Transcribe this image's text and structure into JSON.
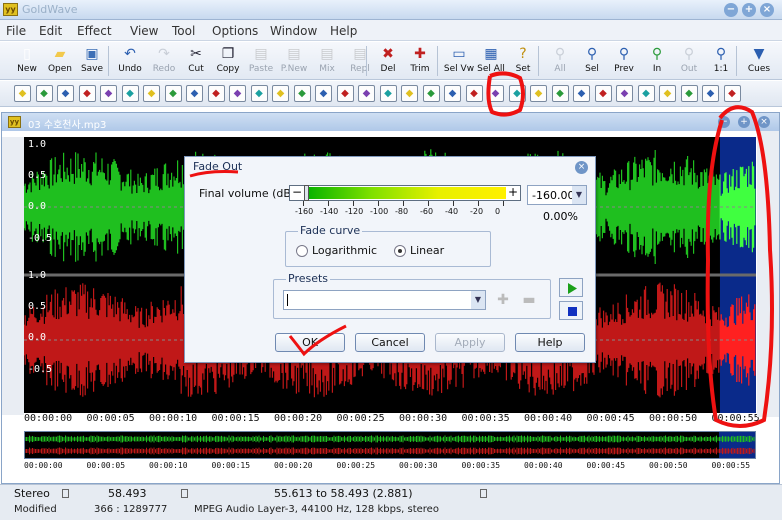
{
  "app": {
    "title": "GoldWave",
    "logo": "yy",
    "window_buttons": [
      "−",
      "+",
      "×"
    ]
  },
  "menu": [
    "File",
    "Edit",
    "Effect",
    "View",
    "Tool",
    "Options",
    "Window",
    "Help"
  ],
  "toolbar": [
    {
      "label": "New",
      "icon": "new-file-icon",
      "glyph": "▯",
      "color": "#ffffff",
      "enabled": true
    },
    {
      "label": "Open",
      "icon": "open-folder-icon",
      "glyph": "▰",
      "color": "#f2c94c",
      "enabled": true
    },
    {
      "label": "Save",
      "icon": "save-disk-icon",
      "glyph": "▣",
      "color": "#3d6fb6",
      "enabled": true
    },
    {
      "label": "Undo",
      "icon": "undo-arrow-icon",
      "glyph": "↶",
      "color": "#2c5fb0",
      "enabled": true
    },
    {
      "label": "Redo",
      "icon": "redo-arrow-icon",
      "glyph": "↷",
      "color": "#9aa3b0",
      "enabled": false
    },
    {
      "label": "Cut",
      "icon": "scissors-icon",
      "glyph": "✂",
      "color": "#223",
      "enabled": true
    },
    {
      "label": "Copy",
      "icon": "copy-icon",
      "glyph": "❐",
      "color": "#223",
      "enabled": true
    },
    {
      "label": "Paste",
      "icon": "paste-icon",
      "glyph": "▤",
      "color": "#999",
      "enabled": false
    },
    {
      "label": "P.New",
      "icon": "paste-new-icon",
      "glyph": "▤",
      "color": "#999",
      "enabled": false
    },
    {
      "label": "Mix",
      "icon": "mix-icon",
      "glyph": "▤",
      "color": "#999",
      "enabled": false
    },
    {
      "label": "Repl",
      "icon": "replace-icon",
      "glyph": "▤",
      "color": "#999",
      "enabled": false
    },
    {
      "label": "Del",
      "icon": "delete-icon",
      "glyph": "✖",
      "color": "#c02020",
      "enabled": true
    },
    {
      "label": "Trim",
      "icon": "trim-icon",
      "glyph": "✚",
      "color": "#c02020",
      "enabled": true
    },
    {
      "label": "Sel Vw",
      "icon": "select-view-icon",
      "glyph": "▭",
      "color": "#2c5fb0",
      "enabled": true
    },
    {
      "label": "Sel All",
      "icon": "select-all-icon",
      "glyph": "▦",
      "color": "#2c5fb0",
      "enabled": true
    },
    {
      "label": "Set",
      "icon": "set-marker-icon",
      "glyph": "?",
      "color": "#c09010",
      "enabled": true
    },
    {
      "label": "All",
      "icon": "zoom-all-icon",
      "glyph": "⚲",
      "color": "#9aa3b0",
      "enabled": false
    },
    {
      "label": "Sel",
      "icon": "zoom-selection-icon",
      "glyph": "⚲",
      "color": "#2c5fb0",
      "enabled": true
    },
    {
      "label": "Prev",
      "icon": "zoom-previous-icon",
      "glyph": "⚲",
      "color": "#2c5fb0",
      "enabled": true
    },
    {
      "label": "In",
      "icon": "zoom-in-icon",
      "glyph": "⚲",
      "color": "#2a9a3a",
      "enabled": true
    },
    {
      "label": "Out",
      "icon": "zoom-out-icon",
      "glyph": "⚲",
      "color": "#9aa3b0",
      "enabled": false
    },
    {
      "label": "1:1",
      "icon": "zoom-actual-icon",
      "glyph": "⚲",
      "color": "#2c5fb0",
      "enabled": true
    },
    {
      "label": "Cues",
      "icon": "cues-icon",
      "glyph": "▼",
      "color": "#2c5fb0",
      "enabled": true
    }
  ],
  "effects_toolbar": [
    "auto-gain-icon",
    "doppler-icon",
    "dynamics-icon",
    "echo-icon",
    "equalizer-icon",
    "fade-in-icon",
    "filter-icon",
    "compressor-icon",
    "invert-icon",
    "mechanize-icon",
    "offset-icon",
    "pan-icon",
    "pitch-icon",
    "resample-icon",
    "reverb-icon",
    "reverse-icon",
    "silence-icon",
    "spectrum-icon",
    "time-warp-icon",
    "volume-icon",
    "fade-in-curve-icon",
    "fade-out-icon",
    "shape-volume-icon",
    "match-volume-icon",
    "maximize-icon",
    "noise-reduction-icon",
    "clip-fix-icon",
    "pop-click-icon",
    "hz-filter-icon",
    "channel-mixer-icon",
    "cd-icon",
    "warning-icon",
    "virus-icon",
    "settings-icon"
  ],
  "document": {
    "title": "03 수호천사.mp3",
    "y_labels_top": [
      "1.0",
      "0.5",
      "0.0",
      "-0.5"
    ],
    "y_labels_bottom": [
      "1.0",
      "0.5",
      "0.0",
      "-0.5"
    ],
    "time_labels": [
      "00:00:00",
      "00:00:05",
      "00:00:10",
      "00:00:15",
      "00:00:20",
      "00:00:25",
      "00:00:30",
      "00:00:35",
      "00:00:40",
      "00:00:45",
      "00:00:50",
      "00:00:55"
    ],
    "overview_labels": [
      "00:00:00",
      "00:00:05",
      "00:00:10",
      "00:00:15",
      "00:00:20",
      "00:00:25",
      "00:00:30",
      "00:00:35",
      "00:00:40",
      "00:00:45",
      "00:00:50",
      "00:00:55"
    ],
    "waveform_colors": {
      "left": "#1fbf1f",
      "right": "#c01818",
      "selection_bg": "#0a2a8a",
      "left_selected": "#40ff40",
      "right_selected": "#ff2020"
    },
    "selection_start": 55.613,
    "selection_end": 58.493,
    "duration": 58.493
  },
  "dialog": {
    "title": "Fade Out",
    "final_volume_label": "Final volume (dB):",
    "final_volume_value": "-160.00",
    "percent": "0.00%",
    "scale_labels": [
      "-160",
      "-140",
      "-120",
      "-100",
      "-80",
      "-60",
      "-40",
      "-20",
      "0"
    ],
    "fade_curve_title": "Fade curve",
    "curve_options": [
      "Logarithmic",
      "Linear"
    ],
    "selected_curve": "Linear",
    "presets_title": "Presets",
    "preset_value": "",
    "buttons": {
      "ok": "OK",
      "cancel": "Cancel",
      "apply": "Apply",
      "help": "Help"
    }
  },
  "status": {
    "channels": "Stereo",
    "duration": "58.493",
    "selection": "55.613 to 58.493 (2.881)",
    "state": "Modified",
    "ratio": "366 : 1289777",
    "format": "MPEG Audio Layer-3, 44100 Hz, 128 kbps, stereo"
  },
  "annotation_color": "#ee1111"
}
